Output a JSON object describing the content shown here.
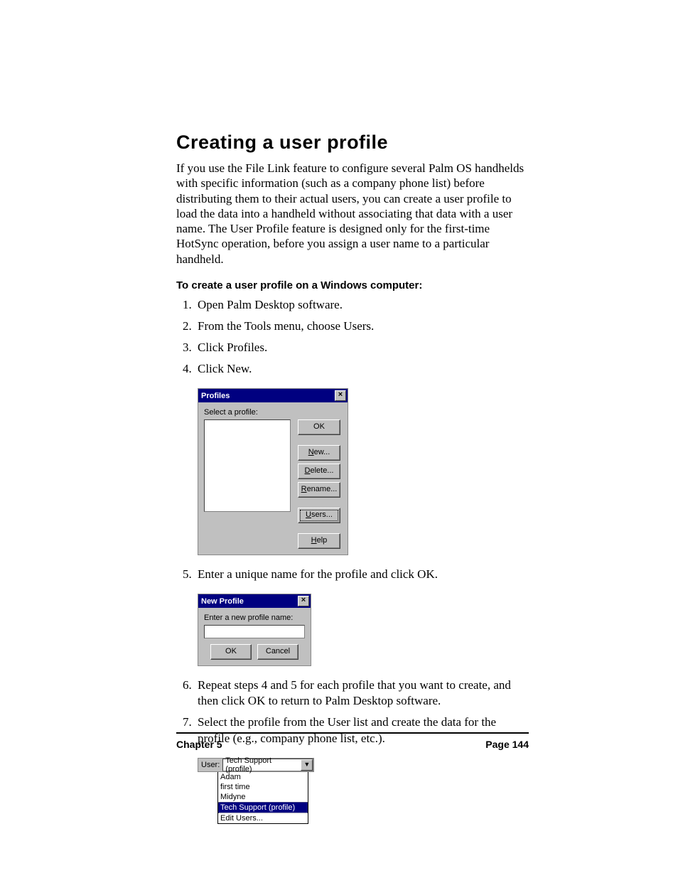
{
  "title": "Creating a user profile",
  "intro": "If you use the File Link feature to configure several Palm OS handhelds with specific information (such as a company phone list) before distributing them to their actual users, you can create a user profile to load the data into a handheld without associating that data with a user name. The User Profile feature is designed only for the first-time HotSync operation, before you assign a user name to a particular handheld.",
  "subhead": "To create a user profile on a Windows computer:",
  "steps": {
    "s1": "Open Palm Desktop software.",
    "s2": "From the Tools menu, choose Users.",
    "s3": "Click Profiles.",
    "s4": "Click New.",
    "s5": "Enter a unique name for the profile and click OK.",
    "s6": "Repeat steps 4 and 5 for each profile that you want to create, and then click OK to return to Palm Desktop software.",
    "s7": "Select the profile from the User list and create the data for the profile (e.g., company phone list, etc.)."
  },
  "profiles_dialog": {
    "title": "Profiles",
    "label": "Select a profile:",
    "buttons": {
      "ok": "OK",
      "new": "New...",
      "delete": "Delete...",
      "rename": "Rename...",
      "users": "Users...",
      "help": "Help"
    }
  },
  "newprofile_dialog": {
    "title": "New Profile",
    "label": "Enter a new profile name:",
    "ok": "OK",
    "cancel": "Cancel"
  },
  "user_dropdown": {
    "label": "User:",
    "selected": "Tech Support (profile)",
    "options": {
      "o1": "Adam",
      "o2": "first time",
      "o3": "Midyne",
      "o4": "Tech Support (profile)",
      "o5": "Edit Users..."
    }
  },
  "footer": {
    "chapter": "Chapter 5",
    "page": "Page 144"
  }
}
